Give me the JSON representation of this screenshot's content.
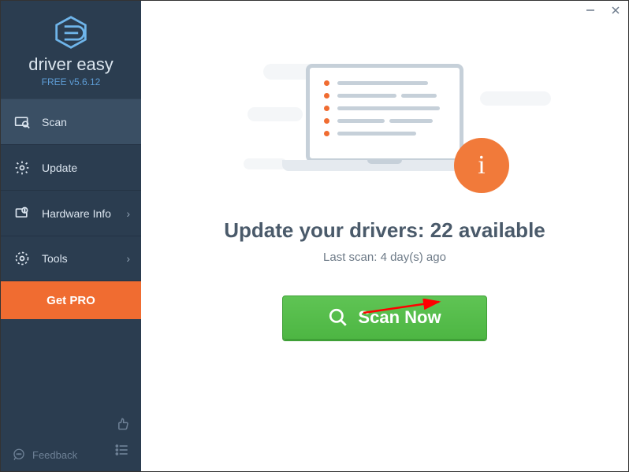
{
  "brand": {
    "name": "driver easy",
    "version": "FREE v5.6.12"
  },
  "nav": {
    "scan": "Scan",
    "update": "Update",
    "hardware": "Hardware Info",
    "tools": "Tools"
  },
  "get_pro": "Get PRO",
  "feedback": "Feedback",
  "main": {
    "headline_prefix": "Update your drivers: ",
    "available_count": 22,
    "headline_suffix": " available",
    "last_scan": "Last scan: 4 day(s) ago",
    "scan_button": "Scan Now"
  }
}
